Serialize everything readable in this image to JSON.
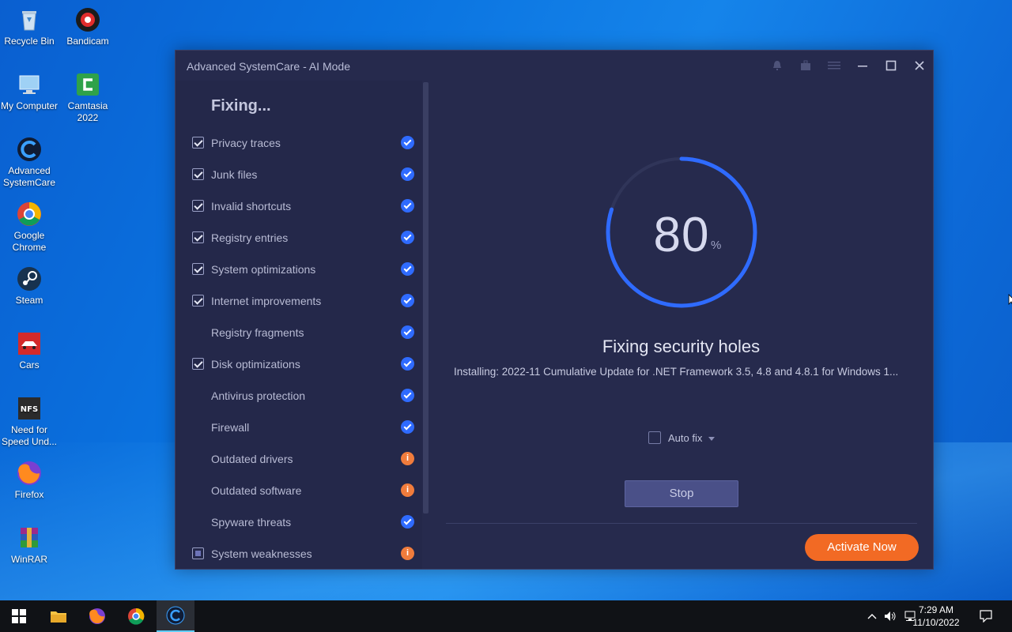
{
  "desktop": {
    "icons": [
      {
        "label": "Recycle Bin",
        "icon": "recycle-bin-icon"
      },
      {
        "label": "Bandicam",
        "icon": "bandicam-icon"
      },
      {
        "label": "My Computer",
        "icon": "computer-icon"
      },
      {
        "label": "Camtasia 2022",
        "icon": "camtasia-icon"
      },
      {
        "label": "Advanced SystemCare",
        "icon": "advanced-systemcare-icon"
      },
      {
        "label": "Google Chrome",
        "icon": "chrome-icon"
      },
      {
        "label": "Steam",
        "icon": "steam-icon"
      },
      {
        "label": "Cars",
        "icon": "cars-icon"
      },
      {
        "label": "Need for Speed Und...",
        "icon": "nfs-icon"
      },
      {
        "label": "Firefox",
        "icon": "firefox-icon"
      },
      {
        "label": "WinRAR",
        "icon": "winrar-icon"
      }
    ]
  },
  "window": {
    "title": "Advanced SystemCare - AI Mode",
    "controls": [
      "notification-icon",
      "toolbox-icon",
      "menu-icon",
      "minimize-icon",
      "maximize-icon",
      "close-icon"
    ]
  },
  "left": {
    "heading": "Fixing...",
    "items": [
      {
        "label": "Privacy traces",
        "checkbox": "checked",
        "status": "ok"
      },
      {
        "label": "Junk files",
        "checkbox": "checked",
        "status": "ok"
      },
      {
        "label": "Invalid shortcuts",
        "checkbox": "checked",
        "status": "ok"
      },
      {
        "label": "Registry entries",
        "checkbox": "checked",
        "status": "ok"
      },
      {
        "label": "System optimizations",
        "checkbox": "checked",
        "status": "ok"
      },
      {
        "label": "Internet improvements",
        "checkbox": "checked",
        "status": "ok"
      },
      {
        "label": "Registry fragments",
        "checkbox": "none",
        "status": "ok"
      },
      {
        "label": "Disk optimizations",
        "checkbox": "checked",
        "status": "ok"
      },
      {
        "label": "Antivirus protection",
        "checkbox": "none",
        "status": "ok"
      },
      {
        "label": "Firewall",
        "checkbox": "none",
        "status": "ok"
      },
      {
        "label": "Outdated drivers",
        "checkbox": "none",
        "status": "warn"
      },
      {
        "label": "Outdated software",
        "checkbox": "none",
        "status": "warn"
      },
      {
        "label": "Spyware threats",
        "checkbox": "none",
        "status": "ok"
      },
      {
        "label": "System weaknesses",
        "checkbox": "partial",
        "status": "warn"
      }
    ]
  },
  "main": {
    "progress_value": "80",
    "progress_unit": "%",
    "progress_fraction": 0.8,
    "status_title": "Fixing security holes",
    "status_detail": "Installing: 2022-11 Cumulative Update for .NET Framework 3.5, 4.8 and 4.8.1 for Windows 1...",
    "autofix_label": "Auto fix",
    "stop_label": "Stop",
    "activate_label": "Activate Now"
  },
  "colors": {
    "accent_blue": "#2f6bff",
    "warning_orange": "#f07c3c",
    "activate_orange": "#f26a24",
    "window_bg": "#262a4d"
  },
  "taskbar": {
    "apps": [
      "start-icon",
      "file-explorer-icon",
      "firefox-icon",
      "chrome-icon",
      "advanced-systemcare-icon"
    ],
    "time": "7:29 AM",
    "date": "11/10/2022"
  }
}
